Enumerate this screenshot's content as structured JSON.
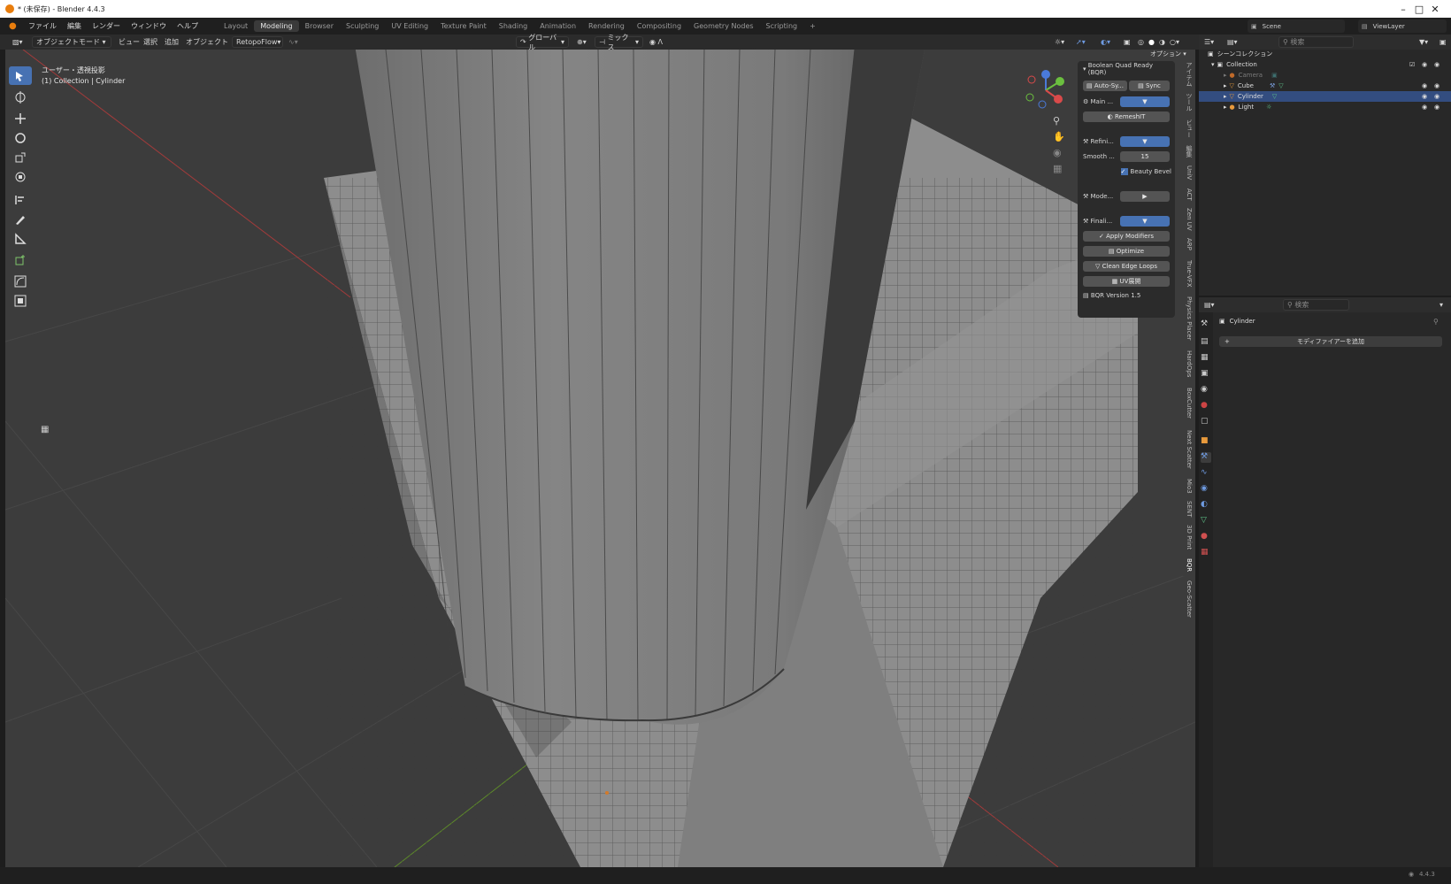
{
  "window": {
    "title": "* (未保存) - Blender 4.4.3"
  },
  "menu": {
    "items": [
      "ファイル",
      "編集",
      "レンダー",
      "ウィンドウ",
      "ヘルプ"
    ]
  },
  "workspaces": [
    "Layout",
    "Modeling",
    "Browser",
    "Sculpting",
    "UV Editing",
    "Texture Paint",
    "Shading",
    "Animation",
    "Rendering",
    "Compositing",
    "Geometry Nodes",
    "Scripting",
    "+"
  ],
  "active_workspace": "Modeling",
  "viewport_header": {
    "mode": "オブジェクトモード",
    "view": "ビュー",
    "select": "選択",
    "add": "追加",
    "object": "オブジェクト",
    "addon": "RetopoFlow",
    "orientation": "グローバル",
    "snap": "ミックス",
    "options": "オプション"
  },
  "viewport_info": {
    "line1": "ユーザー・透視投影",
    "line2": "(1) Collection | Cylinder"
  },
  "bqr_panel": {
    "title": "Boolean Quad Ready (BQR)",
    "auto_sync": "Auto-Sy...",
    "sync": "Sync",
    "main": "Main ...",
    "remeshit": "RemeshIT",
    "refine": "Refini...",
    "smooth_label": "Smooth ...",
    "smooth_value": "15",
    "beauty_bevel": "Beauty Bevel",
    "mode": "Mode...",
    "finalize": "Finali...",
    "apply_modifiers": "Apply Modifiers",
    "optimize": "Optimize",
    "clean_edge_loops": "Clean Edge Loops",
    "uv": "UV展開",
    "version": "BQR Version 1.5"
  },
  "side_tabs": [
    "アイテム",
    "ツール",
    "ビュー",
    "編集",
    "UniV",
    "ACT",
    "Zen UV",
    "ARP",
    "True-VFX",
    "Physics Placer",
    "HardOps",
    "BoxCutter",
    "Next Scatter",
    "Mio3",
    "SENT",
    "3D Print",
    "BQR",
    "Geo-Scatter"
  ],
  "outliner": {
    "scene_label": "Scene",
    "viewlayer_label": "ViewLayer",
    "search_placeholder": "検索",
    "root": "シーンコレクション",
    "collection": "Collection",
    "items": [
      "Camera",
      "Cube",
      "Cylinder",
      "Light"
    ]
  },
  "properties": {
    "search_placeholder": "検索",
    "object_name": "Cylinder",
    "add_modifier": "モディファイアーを追加"
  },
  "status": {
    "version": "4.4.3"
  }
}
